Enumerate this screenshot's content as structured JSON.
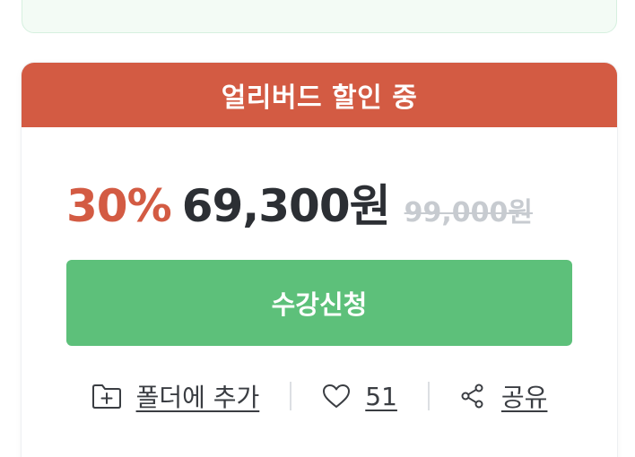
{
  "promo": {
    "banner_text": "얼리버드 할인 중"
  },
  "pricing": {
    "discount_rate": "30%",
    "sale_price": "69,300원",
    "original_price": "99,000원"
  },
  "enroll": {
    "button_label": "수강신청"
  },
  "actions": {
    "folder_label": "폴더에 추가",
    "like_count": "51",
    "share_label": "공유"
  },
  "colors": {
    "accent_red": "#d35b43",
    "accent_green": "#5dc07a",
    "text_dark": "#2c2f34",
    "strike_gray": "#c7cbd0"
  },
  "icons": {
    "folder": "folder-plus-icon",
    "like": "heart-icon",
    "share": "share-icon"
  }
}
